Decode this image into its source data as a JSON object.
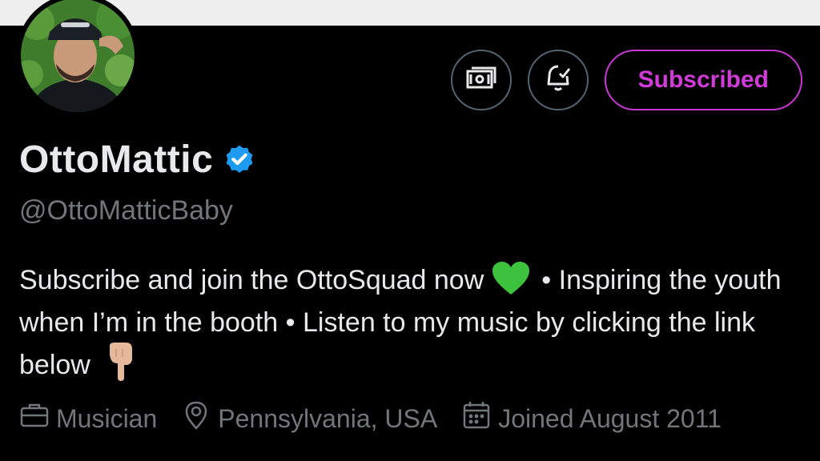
{
  "profile": {
    "display_name": "OttoMattic",
    "handle": "@OttoMatticBaby",
    "bio_part1": "Subscribe and join the OttoSquad now",
    "bio_part2": "• Inspiring the youth when I’m in the booth • Listen to my music by clicking the link below",
    "meta": {
      "profession": "Musician",
      "location": "Pennsylvania, USA",
      "joined": "Joined August 2011"
    }
  },
  "actions": {
    "subscribe_label": "Subscribed"
  },
  "icons": {
    "tip": "money-icon",
    "notifications": "bell-check-icon",
    "verified": "verified-badge-icon",
    "heart": "green-heart-emoji",
    "point": "point-down-emoji",
    "briefcase": "briefcase-icon",
    "location": "location-pin-icon",
    "calendar": "calendar-icon"
  },
  "colors": {
    "background": "#000000",
    "primary_text": "#e7e9ea",
    "secondary_text": "#71767b",
    "subscribed_accent": "#d13bd8",
    "verified_blue": "#1d9bf0",
    "heart_green": "#3cc23c"
  }
}
